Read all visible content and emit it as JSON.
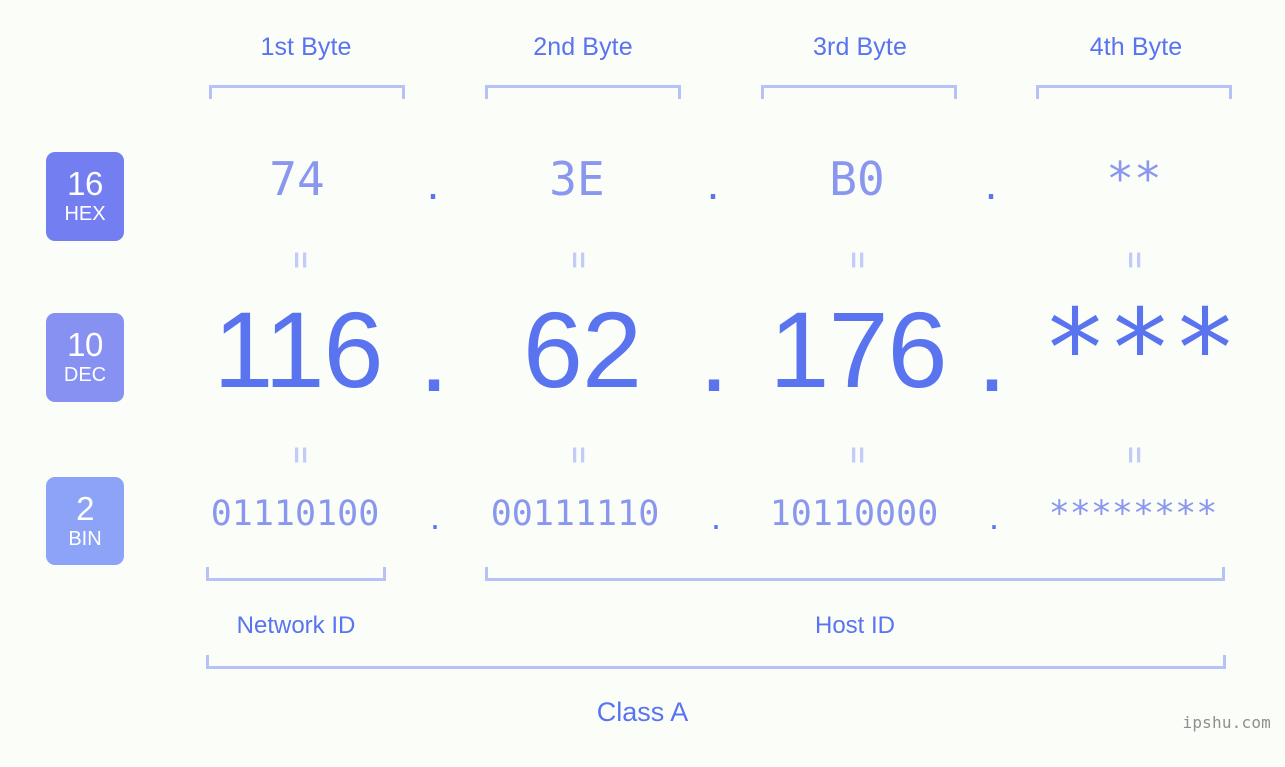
{
  "headers": {
    "bytes": [
      "1st Byte",
      "2nd Byte",
      "3rd Byte",
      "4th Byte"
    ]
  },
  "rows": [
    {
      "base": "16",
      "base_abbr": "HEX",
      "badge_color": "#737ef0",
      "values": [
        "74",
        "3E",
        "B0",
        "**"
      ],
      "separator": "."
    },
    {
      "base": "10",
      "base_abbr": "DEC",
      "badge_color": "#8791f2",
      "values": [
        "116",
        "62",
        "176",
        "***"
      ],
      "separator": "."
    },
    {
      "base": "2",
      "base_abbr": "BIN",
      "badge_color": "#8da3f7",
      "values": [
        "01110100",
        "00111110",
        "10110000",
        "********"
      ],
      "separator": "."
    }
  ],
  "equals_glyph": "=",
  "segments": {
    "network_id": "Network ID",
    "host_id": "Host ID"
  },
  "class_label": "Class A",
  "watermark": "ipshu.com",
  "colors": {
    "background": "#fbfdf8",
    "accent_strong": "#5a73ef",
    "accent_mid": "#8a97ee",
    "accent_light": "#b7c2f8",
    "equals": "#c3ccf9",
    "watermark": "#8f8f8f"
  }
}
